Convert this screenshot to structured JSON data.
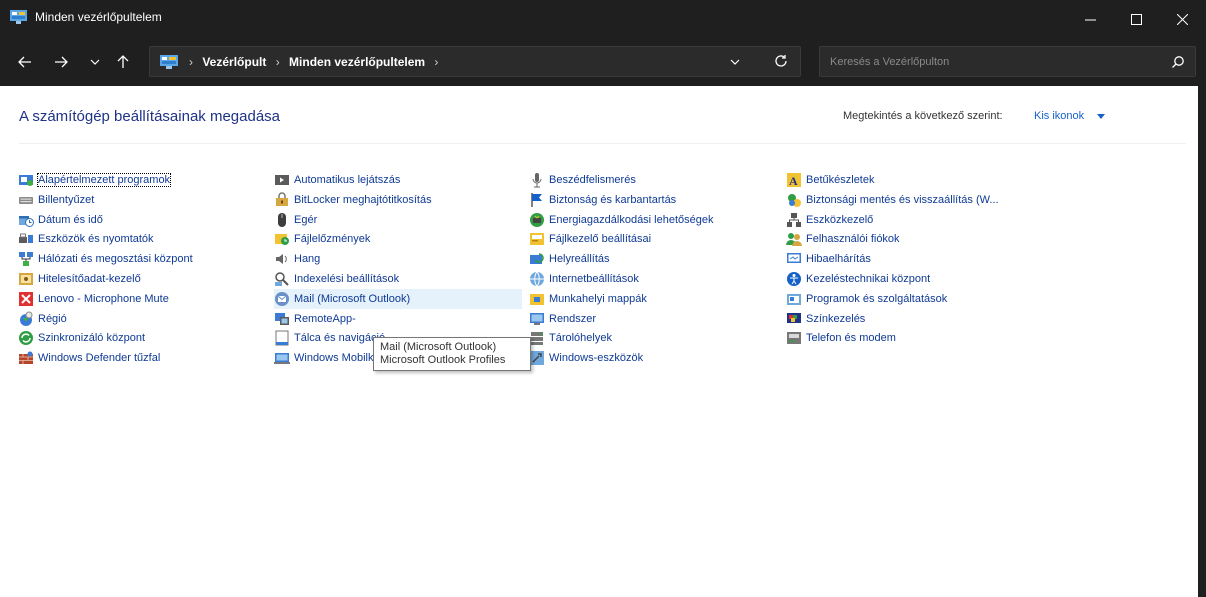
{
  "window": {
    "title": "Minden vezérlőpultelem"
  },
  "address_bar": {
    "crumbs": [
      "Vezérlőpult",
      "Minden vezérlőpultelem"
    ]
  },
  "search": {
    "placeholder": "Keresés a Vezérlőpulton"
  },
  "header": {
    "heading": "A számítógép beállításainak megadása",
    "view_by_label": "Megtekintés a következő szerint:",
    "view_by_value": "Kis ikonok"
  },
  "columns": [
    [
      {
        "label": "Alapértelmezett programok",
        "icon": "default-programs-icon"
      },
      {
        "label": "Billentyűzet",
        "icon": "keyboard-icon"
      },
      {
        "label": "Dátum és idő",
        "icon": "date-time-icon"
      },
      {
        "label": "Eszközök és nyomtatók",
        "icon": "devices-printers-icon"
      },
      {
        "label": "Hálózati és megosztási központ",
        "icon": "network-icon"
      },
      {
        "label": "Hitelesítőadat-kezelő",
        "icon": "credential-manager-icon"
      },
      {
        "label": "Lenovo - Microphone Mute",
        "icon": "microphone-mute-icon"
      },
      {
        "label": "Régió",
        "icon": "region-icon"
      },
      {
        "label": "Szinkronizáló központ",
        "icon": "sync-center-icon"
      },
      {
        "label": "Windows Defender tűzfal",
        "icon": "firewall-icon"
      }
    ],
    [
      {
        "label": "Automatikus lejátszás",
        "icon": "autoplay-icon"
      },
      {
        "label": "BitLocker meghajtótitkosítás",
        "icon": "bitlocker-icon"
      },
      {
        "label": "Egér",
        "icon": "mouse-icon"
      },
      {
        "label": "Fájlelőzmények",
        "icon": "file-history-icon"
      },
      {
        "label": "Hang",
        "icon": "sound-icon"
      },
      {
        "label": "Indexelési beállítások",
        "icon": "indexing-icon"
      },
      {
        "label": "Mail (Microsoft Outlook)",
        "icon": "mail-icon"
      },
      {
        "label": "RemoteApp-",
        "icon": "remoteapp-icon"
      },
      {
        "label": "Tálca és navigáció",
        "icon": "taskbar-icon"
      },
      {
        "label": "Windows Mobilközpont",
        "icon": "mobility-center-icon"
      }
    ],
    [
      {
        "label": "Beszédfelismerés",
        "icon": "speech-recognition-icon"
      },
      {
        "label": "Biztonság és karbantartás",
        "icon": "security-maintenance-icon"
      },
      {
        "label": "Energiagazdálkodási lehetőségek",
        "icon": "power-options-icon"
      },
      {
        "label": "Fájlkezelő beállításai",
        "icon": "explorer-options-icon"
      },
      {
        "label": "Helyreállítás",
        "icon": "recovery-icon"
      },
      {
        "label": "Internetbeállítások",
        "icon": "internet-options-icon"
      },
      {
        "label": "Munkahelyi mappák",
        "icon": "work-folders-icon"
      },
      {
        "label": "Rendszer",
        "icon": "system-icon"
      },
      {
        "label": "Tárolóhelyek",
        "icon": "storage-spaces-icon"
      },
      {
        "label": "Windows-eszközök",
        "icon": "windows-tools-icon"
      }
    ],
    [
      {
        "label": "Betűkészletek",
        "icon": "fonts-icon"
      },
      {
        "label": "Biztonsági mentés és visszaállítás (W...",
        "icon": "backup-restore-icon"
      },
      {
        "label": "Eszközkezelő",
        "icon": "device-manager-icon"
      },
      {
        "label": "Felhasználói fiókok",
        "icon": "user-accounts-icon"
      },
      {
        "label": "Hibaelhárítás",
        "icon": "troubleshooting-icon"
      },
      {
        "label": "Kezeléstechnikai központ",
        "icon": "ease-of-access-icon"
      },
      {
        "label": "Programok és szolgáltatások",
        "icon": "programs-features-icon"
      },
      {
        "label": "Színkezelés",
        "icon": "color-management-icon"
      },
      {
        "label": "Telefon és modem",
        "icon": "phone-modem-icon"
      }
    ]
  ],
  "tooltip": {
    "line1": "Mail (Microsoft Outlook)",
    "line2": "Microsoft Outlook Profiles"
  },
  "colors": {
    "link": "#0f3a94",
    "heading": "#1e3287",
    "titlebar": "#1f1f1f",
    "hover": "#e5f1fb"
  }
}
